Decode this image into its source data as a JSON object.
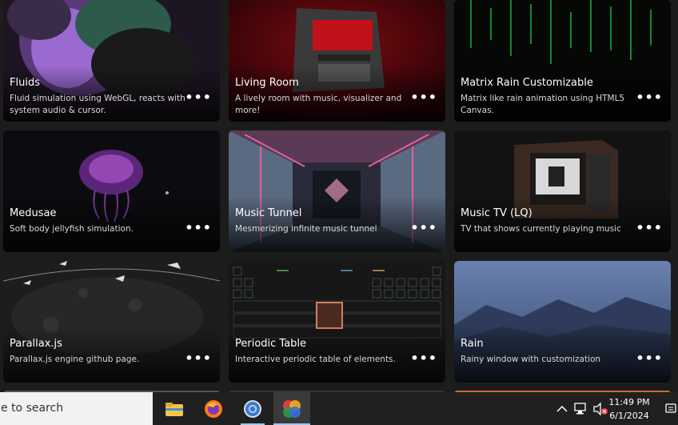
{
  "cards": [
    {
      "title": "Fluids",
      "desc": "Fluid simulation using WebGL, reacts with system audio & cursor.",
      "more": "•••"
    },
    {
      "title": "Living Room",
      "desc": "A lively room with music, visualizer and more!",
      "more": "•••"
    },
    {
      "title": "Matrix Rain Customizable",
      "desc": "Matrix like rain animation using HTML5 Canvas.",
      "more": "•••"
    },
    {
      "title": "Medusae",
      "desc": "Soft body jellyfish simulation.",
      "more": "•••"
    },
    {
      "title": "Music Tunnel",
      "desc": "Mesmerizing infinite music tunnel",
      "more": "•••"
    },
    {
      "title": "Music TV (LQ)",
      "desc": "TV that shows currently playing music",
      "more": "•••"
    },
    {
      "title": "Parallax.js",
      "desc": "Parallax.js engine github page.",
      "more": "•••"
    },
    {
      "title": "Periodic Table",
      "desc": "Interactive periodic table of elements.",
      "more": "•••"
    },
    {
      "title": "Rain",
      "desc": "Rainy window with customization",
      "more": "•••"
    }
  ],
  "taskbar": {
    "search_text": "e to search",
    "apps": [
      "file-explorer-icon",
      "firefox-icon",
      "chrome-icon",
      "lively-icon"
    ],
    "time": "11:49 PM",
    "date": "6/1/2024"
  }
}
